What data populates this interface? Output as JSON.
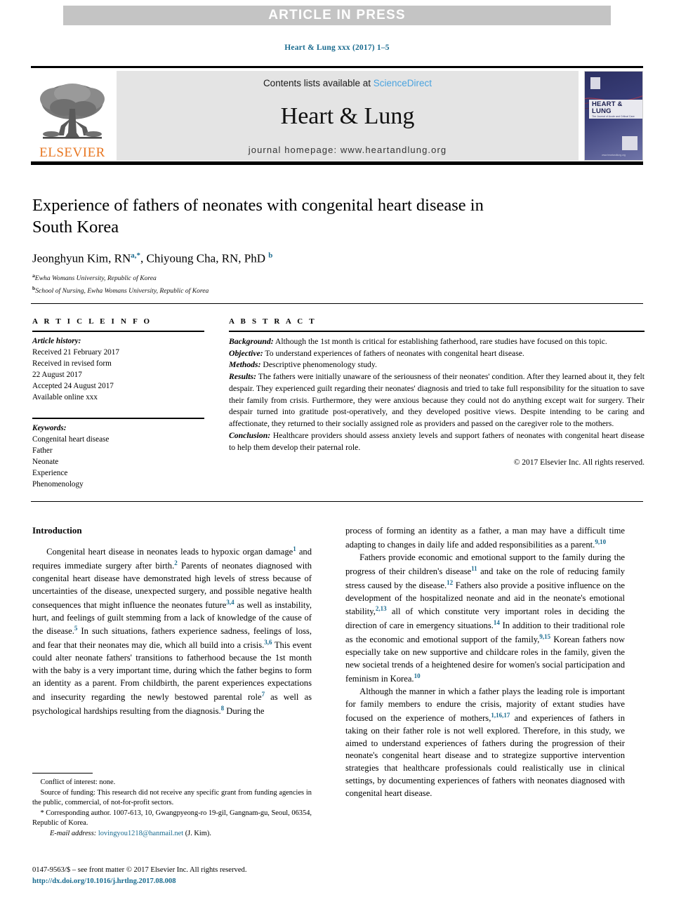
{
  "banner": {
    "text": "ARTICLE IN PRESS"
  },
  "running_head": "Heart & Lung xxx (2017) 1–5",
  "masthead": {
    "contents_prefix": "Contents lists available at ",
    "sciencedirect": "ScienceDirect",
    "journal_title": "Heart & Lung",
    "homepage": "journal homepage: www.heartandlung.org",
    "publisher": "ELSEVIER",
    "cover": {
      "title": "HEART & LUNG",
      "subtitle": "The Journal of Acute and Critical Care",
      "url": "www.heartandlung.org"
    }
  },
  "article": {
    "title": "Experience of fathers of neonates with congenital heart disease in South Korea",
    "authors_html": "Jeonghyun Kim, RN<sup class=\"aff\">a,</sup><sup class=\"aff\">*</sup>, Chiyoung Cha, RN, PhD <sup class=\"aff\">b</sup>",
    "affiliations": [
      {
        "marker": "a",
        "text": "Ewha Womans University, Republic of Korea"
      },
      {
        "marker": "b",
        "text": "School of Nursing, Ewha Womans University, Republic of Korea"
      }
    ]
  },
  "info": {
    "heading": "A R T I C L E   I N F O",
    "history_label": "Article history:",
    "history": [
      "Received 21 February 2017",
      "Received in revised form",
      "22 August 2017",
      "Accepted 24 August 2017",
      "Available online xxx"
    ],
    "keywords_label": "Keywords:",
    "keywords": [
      "Congenital heart disease",
      "Father",
      "Neonate",
      "Experience",
      "Phenomenology"
    ]
  },
  "abstract": {
    "heading": "A B S T R A C T",
    "sections": [
      {
        "label": "Background:",
        "text": " Although the 1st month is critical for establishing fatherhood, rare studies have focused on this topic."
      },
      {
        "label": "Objective:",
        "text": " To understand experiences of fathers of neonates with congenital heart disease."
      },
      {
        "label": "Methods:",
        "text": " Descriptive phenomenology study."
      },
      {
        "label": "Results:",
        "text": " The fathers were initially unaware of the seriousness of their neonates' condition. After they learned about it, they felt despair. They experienced guilt regarding their neonates' diagnosis and tried to take full responsibility for the situation to save their family from crisis. Furthermore, they were anxious because they could not do anything except wait for surgery. Their despair turned into gratitude post-operatively, and they developed positive views. Despite intending to be caring and affectionate, they returned to their socially assigned role as providers and passed on the caregiver role to the mothers."
      },
      {
        "label": "Conclusion:",
        "text": " Healthcare providers should assess anxiety levels and support fathers of neonates with congenital heart disease to help them develop their paternal role."
      }
    ],
    "copyright": "© 2017 Elsevier Inc. All rights reserved."
  },
  "body": {
    "intro_heading": "Introduction",
    "left_paragraphs_html": [
      "Congenital heart disease in neonates leads to hypoxic organ damage<sup class=\"ref\">1</sup> and requires immediate surgery after birth.<sup class=\"ref\">2</sup> Parents of neonates diagnosed with congenital heart disease have demonstrated high levels of stress because of uncertainties of the disease, unexpected surgery, and possible negative health consequences that might influence the neonates future<sup class=\"ref\">3,4</sup> as well as instability, hurt, and feelings of guilt stemming from a lack of knowledge of the cause of the disease.<sup class=\"ref\">5</sup> In such situations, fathers experience sadness, feelings of loss, and fear that their neonates may die, which all build into a crisis.<sup class=\"ref\">3,6</sup> This event could alter neonate fathers' transitions to fatherhood because the 1st month with the baby is a very important time, during which the father begins to form an identity as a parent. From childbirth, the parent experiences expectations and insecurity regarding the newly bestowed parental role<sup class=\"ref\">7</sup> as well as psychological hardships resulting from the diagnosis.<sup class=\"ref\">8</sup> During the"
    ],
    "right_paragraphs_html": [
      "process of forming an identity as a father, a man may have a difficult time adapting to changes in daily life and added responsibilities as a parent.<sup class=\"ref\">9,10</sup>",
      "Fathers provide economic and emotional support to the family during the progress of their children's disease<sup class=\"ref\">11</sup> and take on the role of reducing family stress caused by the disease.<sup class=\"ref\">12</sup> Fathers also provide a positive influence on the development of the hospitalized neonate and aid in the neonate's emotional stability,<sup class=\"ref\">2,13</sup> all of which constitute very important roles in deciding the direction of care in emergency situations.<sup class=\"ref\">14</sup> In addition to their traditional role as the economic and emotional support of the family,<sup class=\"ref\">9,15</sup> Korean fathers now especially take on new supportive and childcare roles in the family, given the new societal trends of a heightened desire for women's social participation and feminism in Korea.<sup class=\"ref\">10</sup>",
      "Although the manner in which a father plays the leading role is important for family members to endure the crisis, majority of extant studies have focused on the experience of mothers,<sup class=\"ref\">1,16,17</sup> and experiences of fathers in taking on their father role is not well explored. Therefore, in this study, we aimed to understand experiences of fathers during the progression of their neonate's congenital heart disease and to strategize supportive intervention strategies that healthcare professionals could realistically use in clinical settings, by documenting experiences of fathers with neonates diagnosed with congenital heart disease."
    ]
  },
  "footnotes": {
    "conflict": "Conflict of interest: none.",
    "funding": "Source of funding: This research did not receive any specific grant from funding agencies in the public, commercial, of not-for-profit sectors.",
    "corresponding": "* Corresponding author. 1007-613, 10, Gwangpyeong-ro 19-gil, Gangnam-gu, Seoul, 06354, Republic of Korea.",
    "email_label": "E-mail address:",
    "email": "lovingyou1218@hanmail.net",
    "email_suffix": "(J. Kim)."
  },
  "imprint": {
    "line1": "0147-9563/$ – see front matter © 2017 Elsevier Inc. All rights reserved.",
    "doi": "http://dx.doi.org/10.1016/j.hrtlng.2017.08.008"
  }
}
